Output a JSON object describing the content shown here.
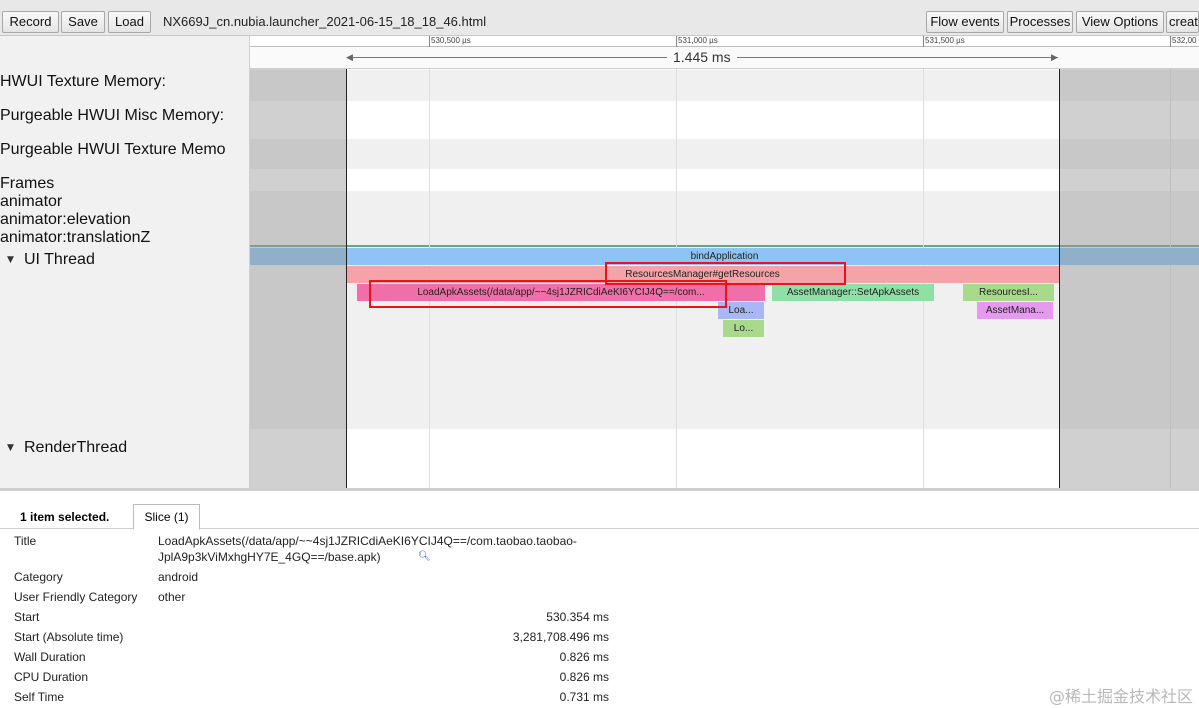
{
  "toolbar": {
    "record": "Record",
    "save": "Save",
    "load": "Load",
    "filename": "NX669J_cn.nubia.launcher_2021-06-15_18_18_46.html",
    "flow_events": "Flow events",
    "processes": "Processes",
    "view_options": "View Options",
    "create": "create"
  },
  "ruler": {
    "ticks": [
      "530,500 µs",
      "531,000 µs",
      "531,500 µs",
      "532,00"
    ],
    "measure": "1.445 ms"
  },
  "tracks": {
    "hwui_texture": "HWUI Texture Memory:",
    "purgeable_misc": "Purgeable HWUI Misc Memory:",
    "purgeable_texture": "Purgeable HWUI Texture Memo",
    "frames": "Frames",
    "animator": "animator",
    "animator_elevation": "animator:elevation",
    "animator_translationz": "animator:translationZ",
    "ui_thread": "UI Thread",
    "render_thread": "RenderThread"
  },
  "slices": {
    "bind_application": "bindApplication",
    "resources_manager": "ResourcesManager#getResources",
    "load_apk_assets": "LoadApkAssets(/data/app/~~4sj1JZRICdiAeKI6YCIJ4Q==/com...",
    "asset_manager_set": "AssetManager::SetApkAssets",
    "resources_impl": "ResourcesI...",
    "asset_mana": "AssetMana...",
    "loa": "Loa...",
    "lo": "Lo..."
  },
  "details": {
    "selected": "1 item selected.",
    "tab": "Slice (1)",
    "title_key": "Title",
    "title_val_1": "LoadApkAssets(/data/app/~~4sj1JZRICdiAeKI6YCIJ4Q==/com.taobao.taobao-",
    "title_val_2": "JplA9p3kViMxhgHY7E_4GQ==/base.apk)",
    "category_key": "Category",
    "category_val": "android",
    "ufc_key": "User Friendly Category",
    "ufc_val": "other",
    "start_key": "Start",
    "start_val": "530.354 ms",
    "start_abs_key": "Start (Absolute time)",
    "start_abs_val": "3,281,708.496 ms",
    "wall_key": "Wall Duration",
    "wall_val": "0.826 ms",
    "cpu_key": "CPU Duration",
    "cpu_val": "0.826 ms",
    "self_key": "Self Time",
    "self_val": "0.731 ms"
  },
  "watermark": "@稀土掘金技术社区",
  "colors": {
    "bind_application": "#8fc3f5",
    "resources_manager": "#f5a3a8",
    "load_apk_assets": "#f06fa8",
    "asset_manager": "#8fe0a6",
    "highlight": "#e8141a"
  }
}
